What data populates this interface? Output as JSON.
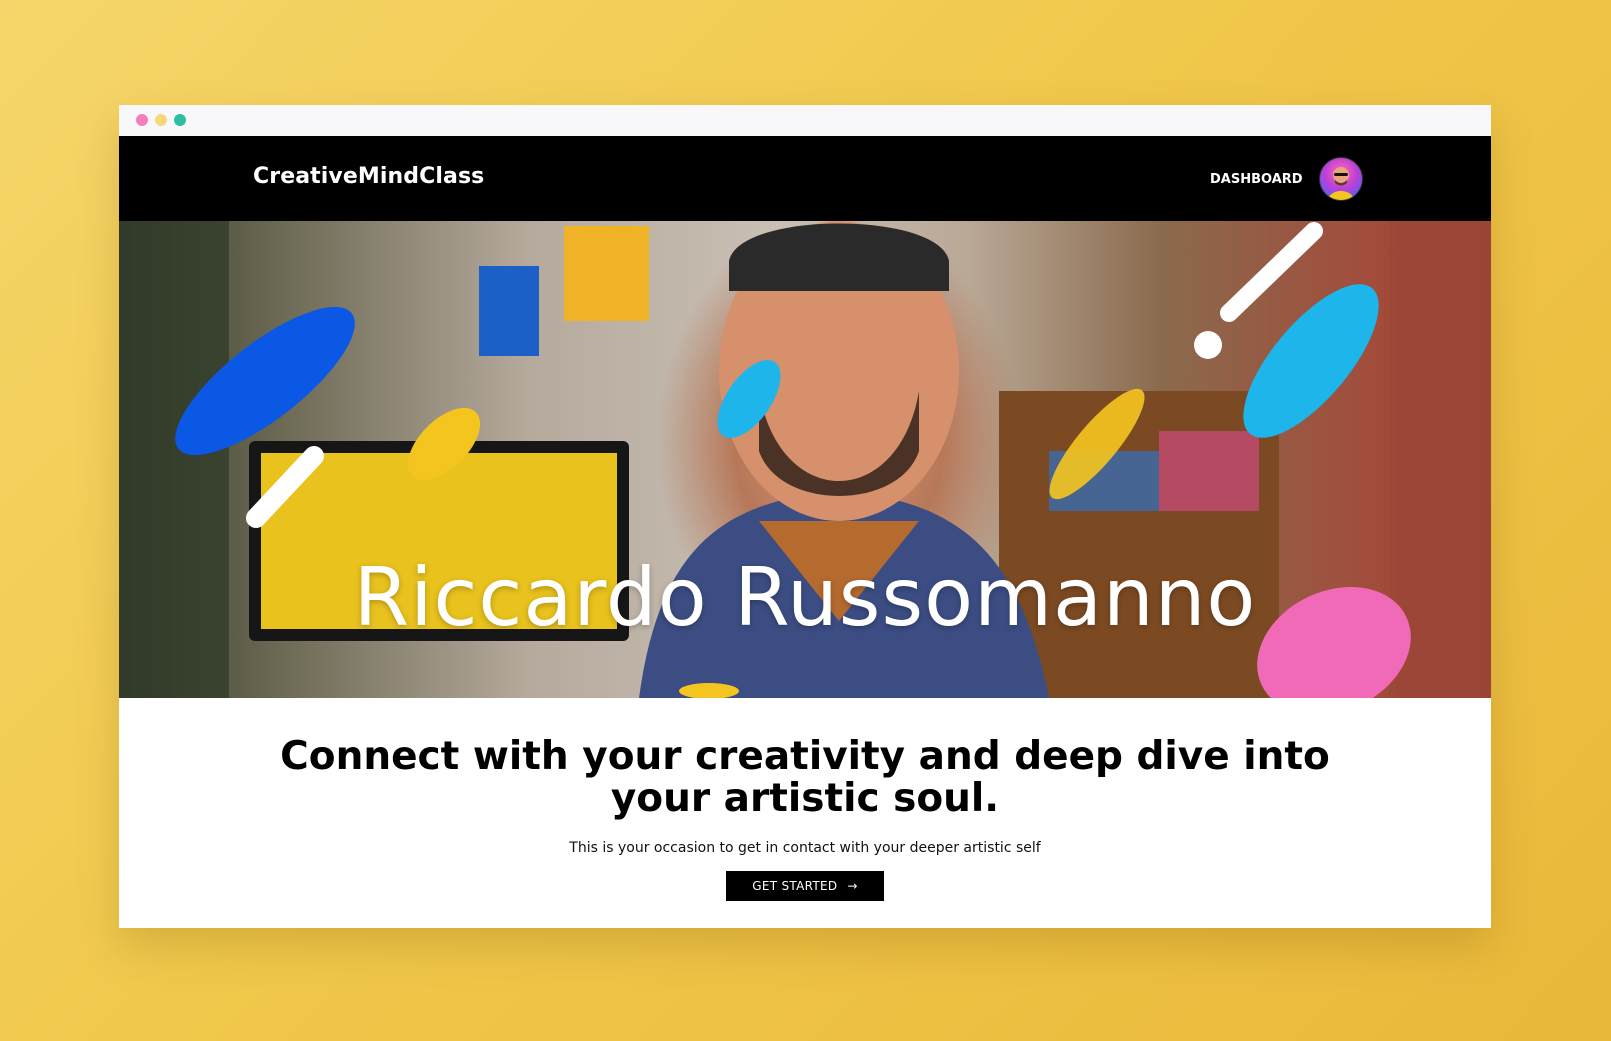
{
  "window": {
    "controls": [
      {
        "name": "close-dot",
        "color": "#f27fb8"
      },
      {
        "name": "minimize-dot",
        "color": "#f6d77a"
      },
      {
        "name": "maximize-dot",
        "color": "#2dbfa0"
      }
    ]
  },
  "navbar": {
    "logo": "CreativeMindClass",
    "dashboard_label": "DASHBOARD",
    "avatar_icon": "user-avatar"
  },
  "hero": {
    "name": "Riccardo Russomanno",
    "accent_colors": [
      "#0a58e4",
      "#1db5ea",
      "#f5c51f",
      "#f06ab8",
      "#ffffff"
    ]
  },
  "main": {
    "headline": "Connect with your creativity and deep dive into your artistic soul.",
    "subtext": "This is your occasion to get in contact with your deeper artistic self",
    "cta_label": "GET STARTED",
    "cta_icon": "arrow-right-icon"
  }
}
